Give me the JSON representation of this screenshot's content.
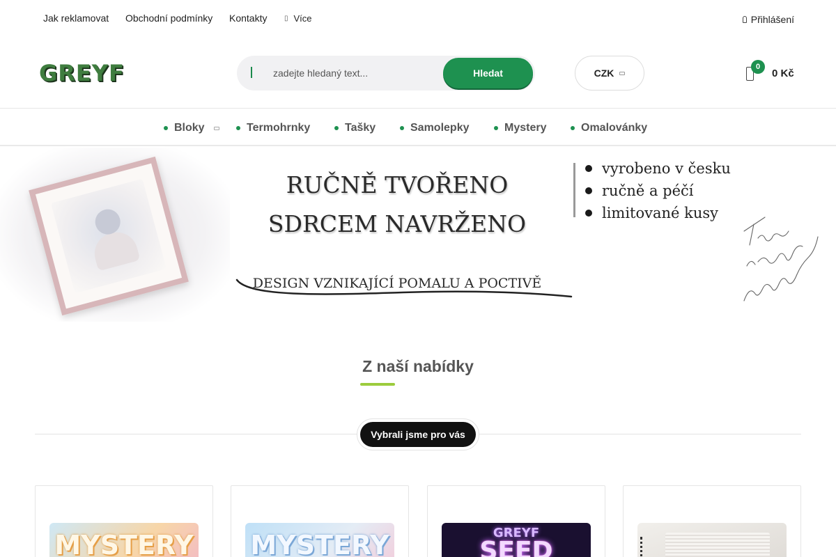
{
  "topbar": {
    "links": [
      "Jak reklamovat",
      "Obchodní podmínky",
      "Kontakty"
    ],
    "more_label": "Více",
    "login_label": "Přihlášení"
  },
  "header": {
    "logo_text": "GREYF",
    "search": {
      "placeholder": "zadejte hledaný text...",
      "button_label": "Hledat"
    },
    "currency": "CZK",
    "cart": {
      "count": "0",
      "total": "0 Kč"
    }
  },
  "nav": {
    "items": [
      "Bloky",
      "Termohrnky",
      "Tašky",
      "Samolepky",
      "Mystery",
      "Omalovánky"
    ]
  },
  "banner": {
    "title_line1": "RUČNĚ TVOŘENO",
    "title_line2": "SDRCEM NAVRŽENO",
    "subtitle": "DESIGN VZNIKAJÍCÍ POMALU A POCTIVĚ",
    "bullets": [
      "vyrobeno v česku",
      "ručně a péčí",
      "limitované kusy"
    ],
    "handwritten": "Tvořeno s láskou k detailu Jan"
  },
  "section": {
    "title": "Z naší nabídky",
    "tab_label": "Vybrali jsme pro vás"
  },
  "products": [
    {
      "image_text": "MYSTERY",
      "bg": "#f5c98a"
    },
    {
      "image_text": "MYSTERY",
      "bg": "#a9d6f2"
    },
    {
      "image_text_top": "GREYF",
      "image_text": "SEED",
      "bg": "#1a1030"
    },
    {
      "image_text": "",
      "bg": "#e9e6e2"
    }
  ],
  "colors": {
    "accent_green": "#1e9150",
    "underline_lime": "#9ccc3d",
    "logo_green": "#3f7d3f"
  },
  "icons": [
    "menu-dots-icon",
    "user-icon",
    "search-icon",
    "chevron-down-icon",
    "cart-bag-icon"
  ]
}
